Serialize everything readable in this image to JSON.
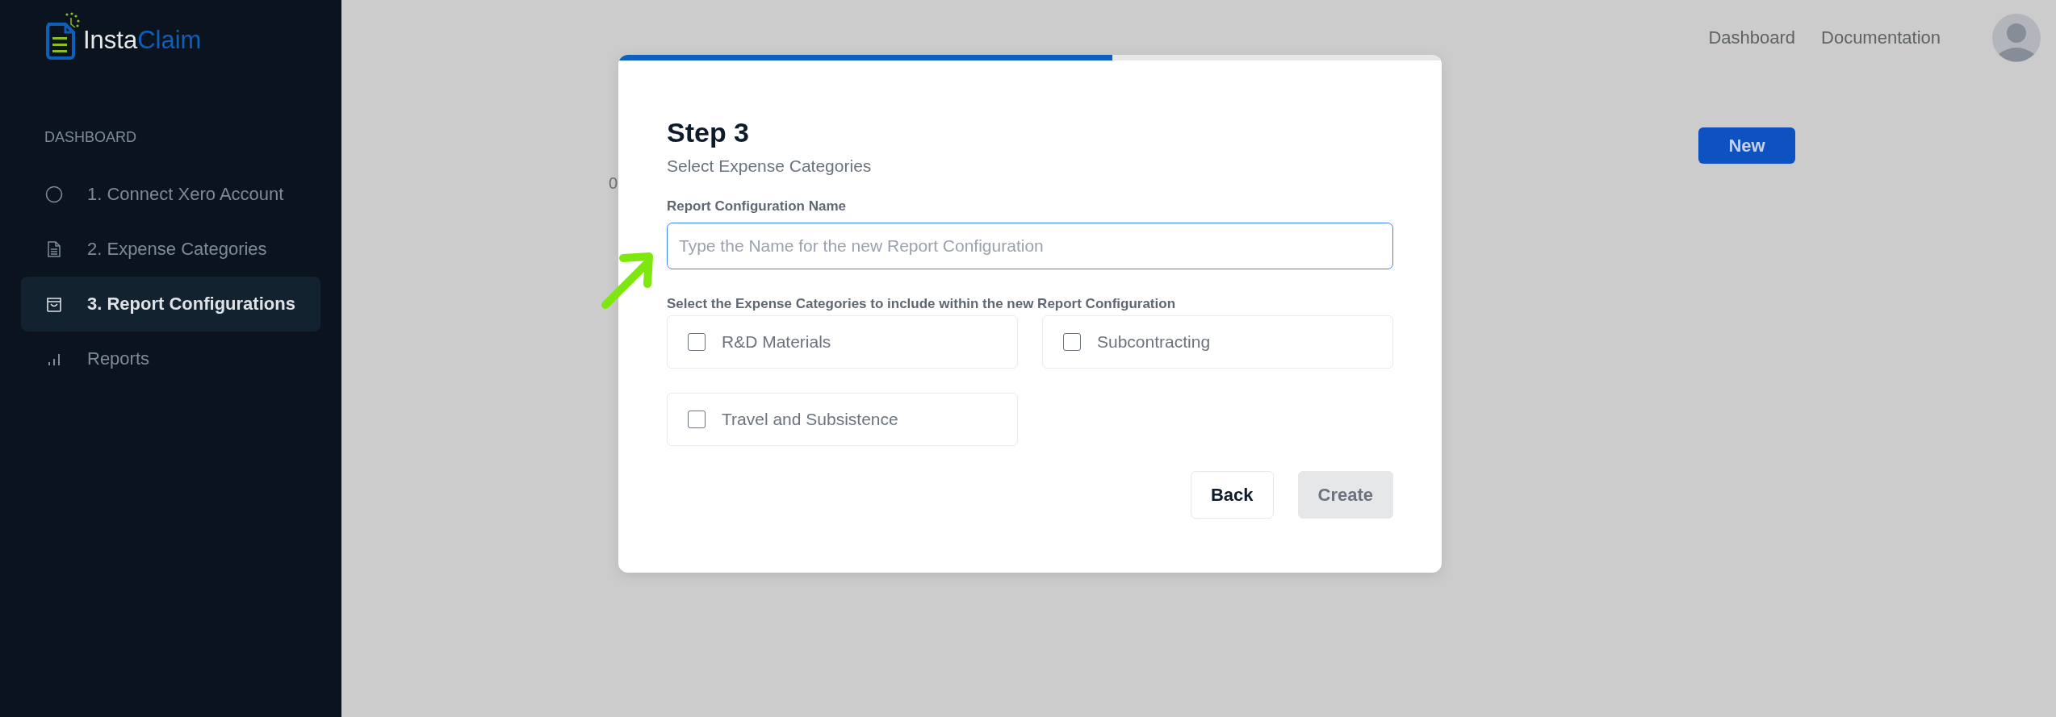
{
  "logo": {
    "text_1": "Insta",
    "text_2": "Claim"
  },
  "sidebar": {
    "section": "DASHBOARD",
    "items": [
      {
        "label": "1. Connect Xero Account",
        "kind": "circle",
        "selected": false
      },
      {
        "label": "2. Expense Categories",
        "kind": "document",
        "selected": false
      },
      {
        "label": "3. Report Configurations",
        "kind": "bag",
        "selected": true
      },
      {
        "label": "Reports",
        "kind": "bars",
        "selected": false
      }
    ]
  },
  "header": {
    "links": [
      "Dashboard",
      "Documentation"
    ]
  },
  "page": {
    "subtitle": "0",
    "new_button": "New"
  },
  "modal": {
    "progress": {
      "level": 0.6
    },
    "title": "Step 3",
    "subtitle": "Select Expense Categories",
    "name_field": {
      "label": "Report Configuration Name",
      "placeholder": "Type the Name for the new Report Configuration"
    },
    "categories_label": "Select the Expense Categories to include within the new Report Configuration",
    "categories": [
      {
        "label": "R&D Materials",
        "checked": false
      },
      {
        "label": "Subcontracting",
        "checked": false
      },
      {
        "label": "Travel and Subsistence",
        "checked": false
      }
    ],
    "buttons": [
      {
        "label": "Back",
        "disabled": false
      },
      {
        "label": "Create",
        "disabled": true
      }
    ]
  }
}
